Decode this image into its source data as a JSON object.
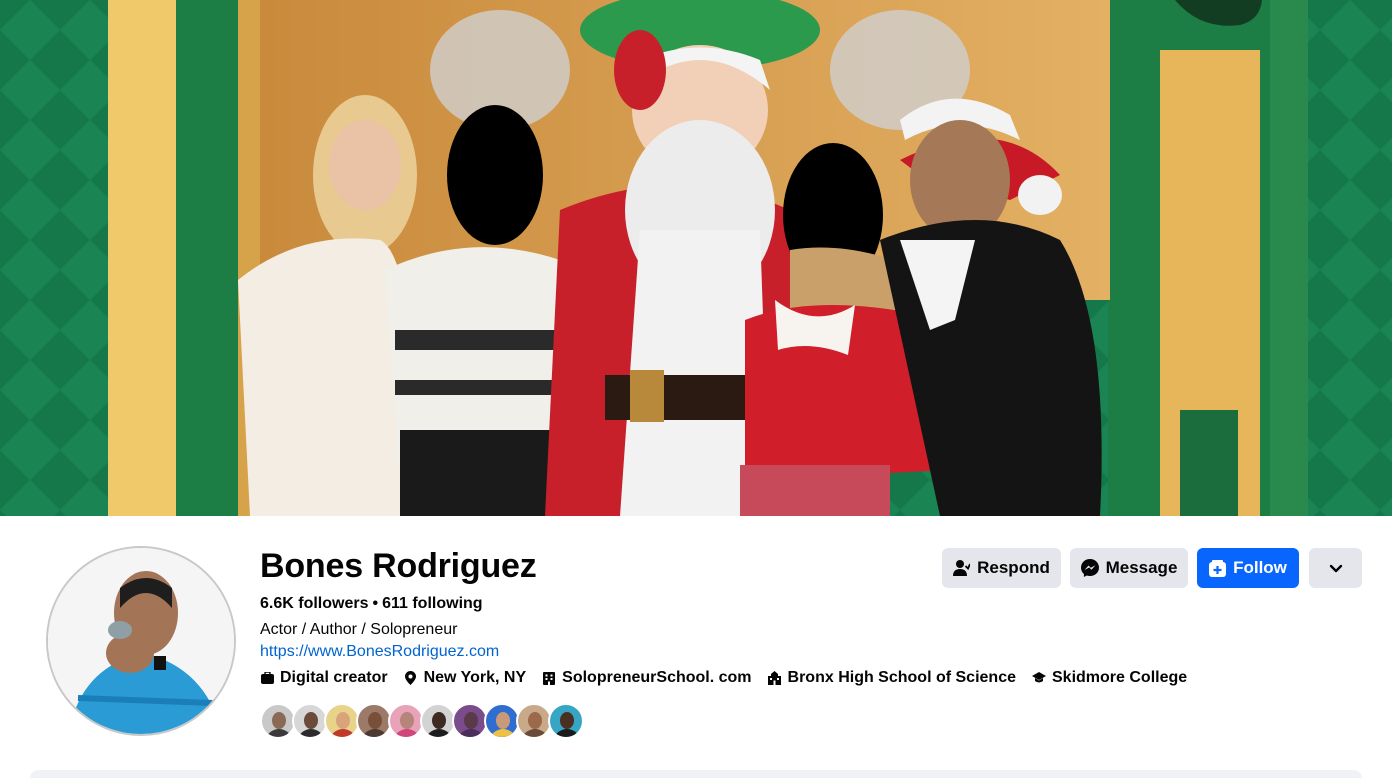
{
  "profile": {
    "name": "Bones Rodriguez",
    "followers": "6.6K followers",
    "separator": "•",
    "following": "611 following",
    "tagline": "Actor / Author / Solopreneur",
    "website": "https://www.BonesRodriguez.com"
  },
  "details": [
    {
      "icon": "briefcase-icon",
      "label": "Digital creator"
    },
    {
      "icon": "location-pin-icon",
      "label": "New York, NY"
    },
    {
      "icon": "building-icon",
      "label": "SolopreneurSchool. com"
    },
    {
      "icon": "school-icon",
      "label": "Bronx High School of Science"
    },
    {
      "icon": "graduation-cap-icon",
      "label": "Skidmore College"
    }
  ],
  "actions": {
    "respond_label": "Respond",
    "message_label": "Message",
    "follow_label": "Follow",
    "more_icon": "chevron-down-icon"
  },
  "colors": {
    "accent": "#0866ff",
    "link": "#0064d1",
    "button_gray": "#e4e6eb"
  }
}
